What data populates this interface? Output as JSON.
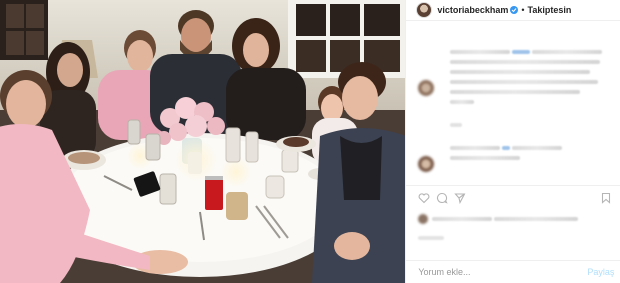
{
  "header": {
    "username": "victoriabeckham",
    "separator": "•",
    "follow_label": "Takiptesin"
  },
  "photo": {
    "can_label": "Coca-Cola"
  },
  "comment_box": {
    "placeholder": "Yorum ekle...",
    "share_label": "Paylaş"
  },
  "colors": {
    "verified_blue": "#3897f0",
    "share_disabled": "#b2dffc",
    "muted_text": "#999999"
  },
  "icons": [
    "verified-badge-icon",
    "heart-icon",
    "comment-icon",
    "share-icon",
    "bookmark-icon"
  ]
}
